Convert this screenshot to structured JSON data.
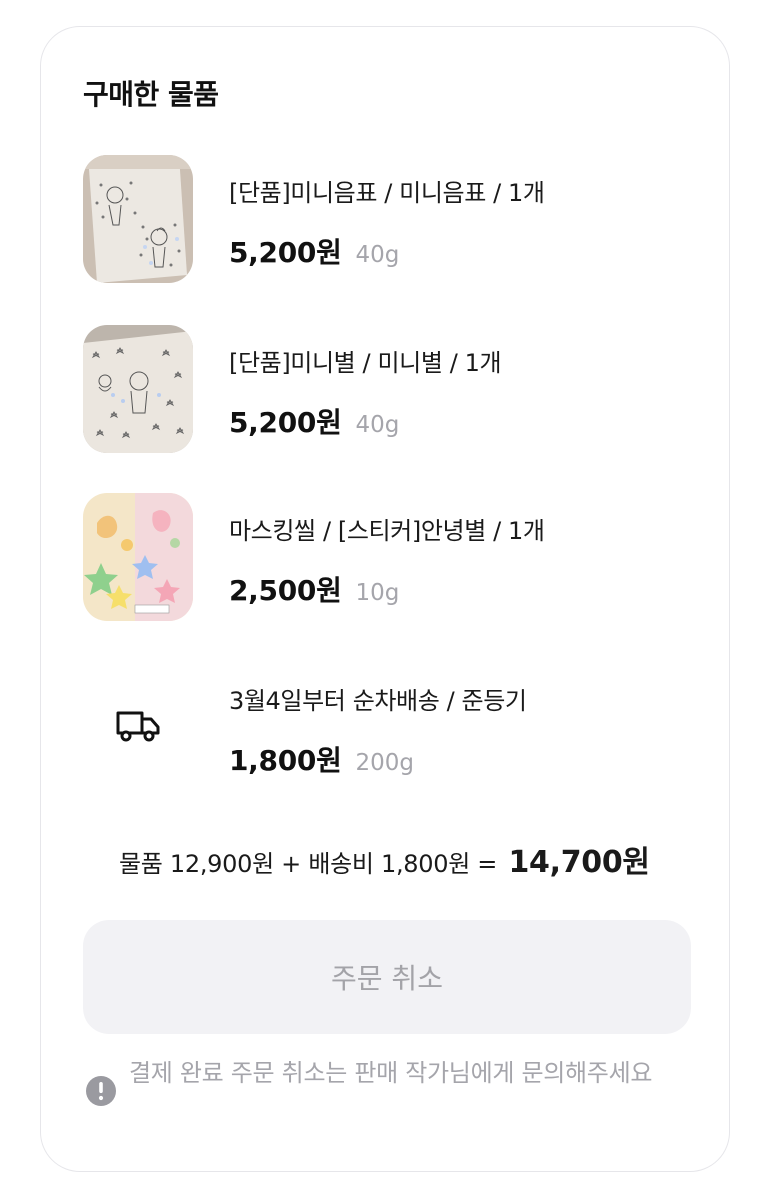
{
  "section_title": "구매한 물품",
  "items": [
    {
      "name": "[단품]미니음표 / 미니음표 / 1개",
      "price": "5,200원",
      "weight": "40g",
      "thumbnail": "sketch-sticker-photo-1"
    },
    {
      "name": "[단품]미니별 / 미니별 / 1개",
      "price": "5,200원",
      "weight": "40g",
      "thumbnail": "sketch-sticker-photo-2"
    },
    {
      "name": "마스킹씰 / [스티커]안녕별 / 1개",
      "price": "2,500원",
      "weight": "10g",
      "thumbnail": "colorful-sticker-photo"
    }
  ],
  "shipping": {
    "icon": "truck-icon",
    "name": "3월4일부터 순차배송 / 준등기",
    "price": "1,800원",
    "weight": "200g"
  },
  "summary": {
    "formula": "물품 12,900원 + 배송비 1,800원 =",
    "total": "14,700원"
  },
  "cancel_button": {
    "label": "주문 취소",
    "state": "disabled"
  },
  "notice": {
    "icon": "exclamation-circle-icon",
    "text": "결제 완료 주문 취소는 판매 작가님에게 문의해주세요"
  },
  "colors": {
    "card_border": "#e6e6ea",
    "muted_text": "#a5a5ab",
    "button_bg": "#f2f2f5",
    "notice_icon": "#9a9aa0"
  }
}
